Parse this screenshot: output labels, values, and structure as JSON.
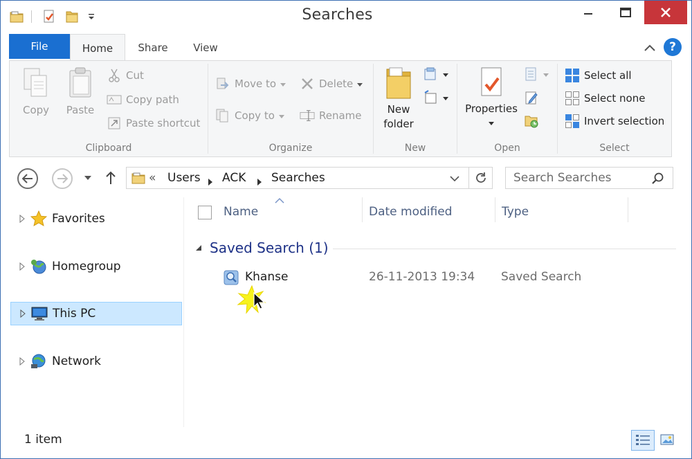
{
  "window": {
    "title": "Searches",
    "accent_color": "#1a6fd1",
    "close_color": "#c7353a"
  },
  "quick_access_toolbar": {
    "icons": [
      "folder-icon",
      "properties-icon",
      "new-folder-icon",
      "customize-dropdown-icon"
    ]
  },
  "ribbon_tabs": {
    "file": "File",
    "home": "Home",
    "share": "Share",
    "view": "View",
    "active": "Home"
  },
  "ribbon": {
    "clipboard": {
      "label": "Clipboard",
      "copy": "Copy",
      "paste": "Paste",
      "cut": "Cut",
      "copy_path": "Copy path",
      "paste_shortcut": "Paste shortcut"
    },
    "organize": {
      "label": "Organize",
      "move_to": "Move to",
      "copy_to": "Copy to",
      "delete": "Delete",
      "rename": "Rename"
    },
    "new": {
      "label": "New",
      "new_folder_line1": "New",
      "new_folder_line2": "folder"
    },
    "open": {
      "label": "Open",
      "properties": "Properties"
    },
    "select": {
      "label": "Select",
      "select_all": "Select all",
      "select_none": "Select none",
      "invert_selection": "Invert selection"
    }
  },
  "address_bar": {
    "overflow": "«",
    "segments": [
      "Users",
      "ACK",
      "Searches"
    ]
  },
  "search": {
    "placeholder": "Search Searches"
  },
  "nav_pane": {
    "items": [
      {
        "label": "Favorites",
        "icon": "star-icon"
      },
      {
        "label": "Homegroup",
        "icon": "homegroup-icon"
      },
      {
        "label": "This PC",
        "icon": "computer-icon",
        "selected": true
      },
      {
        "label": "Network",
        "icon": "network-icon"
      }
    ]
  },
  "file_list": {
    "columns": {
      "name": "Name",
      "date_modified": "Date modified",
      "type": "Type"
    },
    "group": {
      "title": "Saved Search (1)"
    },
    "rows": [
      {
        "name": "Khanse",
        "date_modified": "26-11-2013 19:34",
        "type": "Saved Search",
        "icon": "saved-search-icon"
      }
    ]
  },
  "status_bar": {
    "item_count": "1 item",
    "active_view": "details"
  }
}
